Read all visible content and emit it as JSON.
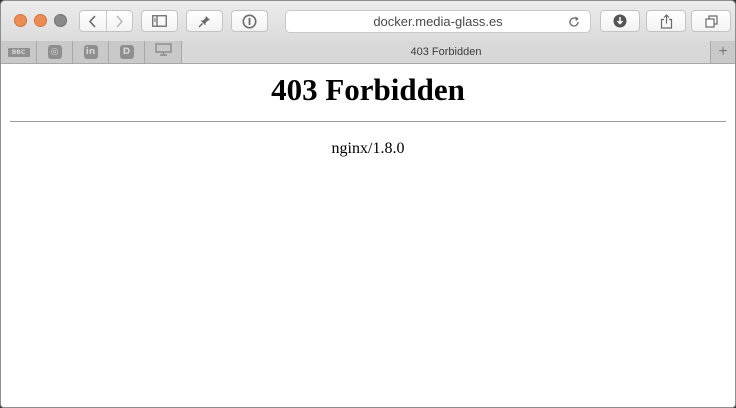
{
  "browser": {
    "address": "docker.media-glass.es",
    "tab_title": "403 Forbidden",
    "new_tab_symbol": "+",
    "pinned_tabs": [
      {
        "icon": "bbc-icon",
        "glyph": "BBC"
      },
      {
        "icon": "instagram-icon",
        "glyph": "◎"
      },
      {
        "icon": "linkedin-icon",
        "glyph": "in"
      },
      {
        "icon": "d-site-icon",
        "glyph": "D"
      },
      {
        "icon": "screen-icon",
        "glyph": "▭"
      }
    ],
    "colors": {
      "close": "#ec8c55",
      "minimize": "#ec8c55",
      "maximize": "#8a8a8a"
    }
  },
  "page": {
    "heading": "403 Forbidden",
    "server": "nginx/1.8.0"
  }
}
